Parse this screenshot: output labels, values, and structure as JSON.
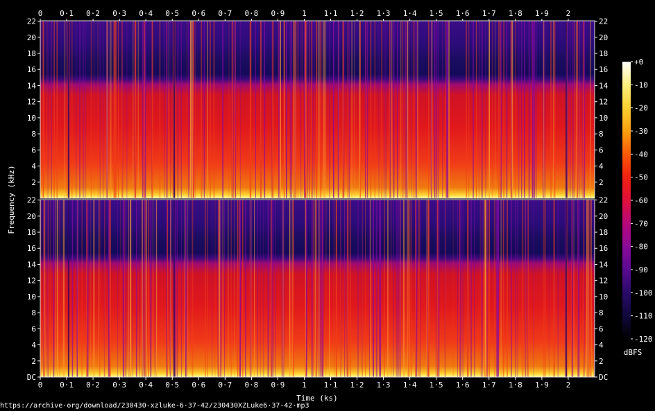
{
  "chart_data": {
    "type": "heatmap",
    "subtype": "spectrogram",
    "channels": 2,
    "x": {
      "label": "Time (ks)",
      "ticks": [
        "0",
        "0·1",
        "0·2",
        "0·3",
        "0·4",
        "0·5",
        "0·6",
        "0·7",
        "0·8",
        "0·9",
        "1",
        "1·1",
        "1·2",
        "1·3",
        "1·4",
        "1·5",
        "1·6",
        "1·7",
        "1·8",
        "1·9",
        "2"
      ],
      "tick_values": [
        0,
        0.1,
        0.2,
        0.3,
        0.4,
        0.5,
        0.6,
        0.7,
        0.8,
        0.9,
        1.0,
        1.1,
        1.2,
        1.3,
        1.4,
        1.5,
        1.6,
        1.7,
        1.8,
        1.9,
        2.0
      ],
      "range": [
        0,
        2.1
      ]
    },
    "y": {
      "label": "Frequency (kHz)",
      "ticks": [
        "DC",
        "2",
        "4",
        "6",
        "8",
        "10",
        "12",
        "14",
        "16",
        "18",
        "20",
        "22"
      ],
      "tick_values": [
        0,
        2,
        4,
        6,
        8,
        10,
        12,
        14,
        16,
        18,
        20,
        22
      ],
      "range": [
        0,
        22.05
      ]
    },
    "colorbar": {
      "label": "dBFS",
      "ticks": [
        "+0",
        "-10",
        "-20",
        "-30",
        "-40",
        "-50",
        "-60",
        "-70",
        "-80",
        "-90",
        "-100",
        "-110",
        "-120"
      ],
      "tick_values": [
        0,
        -10,
        -20,
        -30,
        -40,
        -50,
        -60,
        -70,
        -80,
        -90,
        -100,
        -110,
        -120
      ],
      "range": [
        -120,
        0
      ],
      "colors": [
        "#000000",
        "#10083a",
        "#2a0a6a",
        "#5a0a90",
        "#8a0a9a",
        "#b8087a",
        "#e0103a",
        "#f02010",
        "#fa5a08",
        "#fca010",
        "#fcd030",
        "#fff080",
        "#ffffff"
      ]
    },
    "bandwidth_cutoff_khz": 15,
    "caption": "https://archive·org/download/230430-xzluke-6·37-42/230430XZLuke6·37-42·mp3"
  }
}
